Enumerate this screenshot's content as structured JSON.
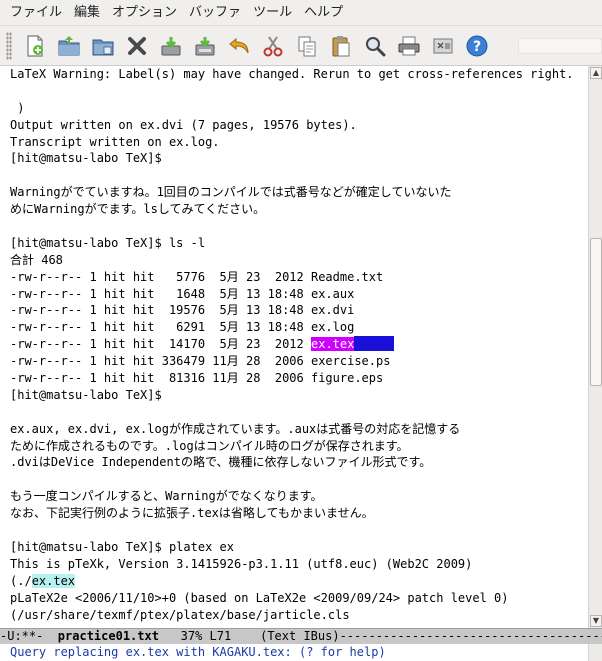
{
  "menubar": {
    "items": [
      "ファイル",
      "編集",
      "オプション",
      "バッファ",
      "ツール",
      "ヘルプ"
    ]
  },
  "toolbar": {
    "icons": [
      "new-file-icon",
      "open-file-icon",
      "open-directory-icon",
      "close-icon",
      "save-icon",
      "save-as-icon",
      "undo-icon",
      "cut-icon",
      "copy-icon",
      "paste-icon",
      "search-icon",
      "print-icon",
      "preferences-icon",
      "help-icon"
    ]
  },
  "buffer": {
    "lines": [
      "LaTeX Warning: Label(s) may have changed. Rerun to get cross-references right.",
      "",
      " )",
      "Output written on ex.dvi (7 pages, 19576 bytes).",
      "Transcript written on ex.log.",
      "[hit@matsu-labo TeX]$",
      "",
      "Warningがでていますね。1回目のコンパイルでは式番号などが確定していないた",
      "めにWarningがでます。lsしてみてください。",
      "",
      "[hit@matsu-labo TeX]$ ls -l",
      "合計 468",
      "-rw-r--r-- 1 hit hit   5776  5月 23  2012 Readme.txt",
      "-rw-r--r-- 1 hit hit   1648  5月 13 18:48 ex.aux",
      "-rw-r--r-- 1 hit hit  19576  5月 13 18:48 ex.dvi",
      "-rw-r--r-- 1 hit hit   6291  5月 13 18:48 ex.log",
      "-rw-r--r-- 1 hit hit  14170  5月 23  2012 ",
      "-rw-r--r-- 1 hit hit 336479 11月 28  2006 exercise.ps",
      "-rw-r--r-- 1 hit hit  81316 11月 28  2006 figure.eps",
      "[hit@matsu-labo TeX]$",
      "",
      "ex.aux, ex.dvi, ex.logが作成されています。.auxは式番号の対応を記憶する",
      "ために作成されるものです。.logはコンパイル時のログが保存されます。",
      ".dviはDeVice Independentの略で、機種に依存しないファイル形式です。",
      "",
      "もう一度コンパイルすると、Warningがでなくなります。",
      "なお、下記実行例のように拡張子.texは省略してもかまいません。",
      "",
      "[hit@matsu-labo TeX]$ platex ex",
      "This is pTeXk, Version 3.1415926-p3.1.11 (utf8.euc) (Web2C 2009)",
      "(./",
      "pLaTeX2e <2006/11/10>+0 (based on LaTeX2e <2009/09/24> patch level 0)",
      "(/usr/share/texmf/ptex/platex/base/jarticle.cls"
    ],
    "match_text": "ex.tex",
    "cyan_text": "ex.tex"
  },
  "modeline": {
    "prefix": "-U:**-  ",
    "buffer_name": "practice01.txt",
    "position": "   37% L71",
    "mode": "    (Text IBus)",
    "fill": "----------------------------------------"
  },
  "minibuffer": {
    "prompt": "Query replacing ex.tex with KAGAKU.tex: (? for help)"
  },
  "colors": {
    "match_bg": "#d000ff",
    "cursor": "#1a10d8",
    "cyan_highlight": "#b6f0f0",
    "minibuffer_text": "#1a3aa8"
  }
}
